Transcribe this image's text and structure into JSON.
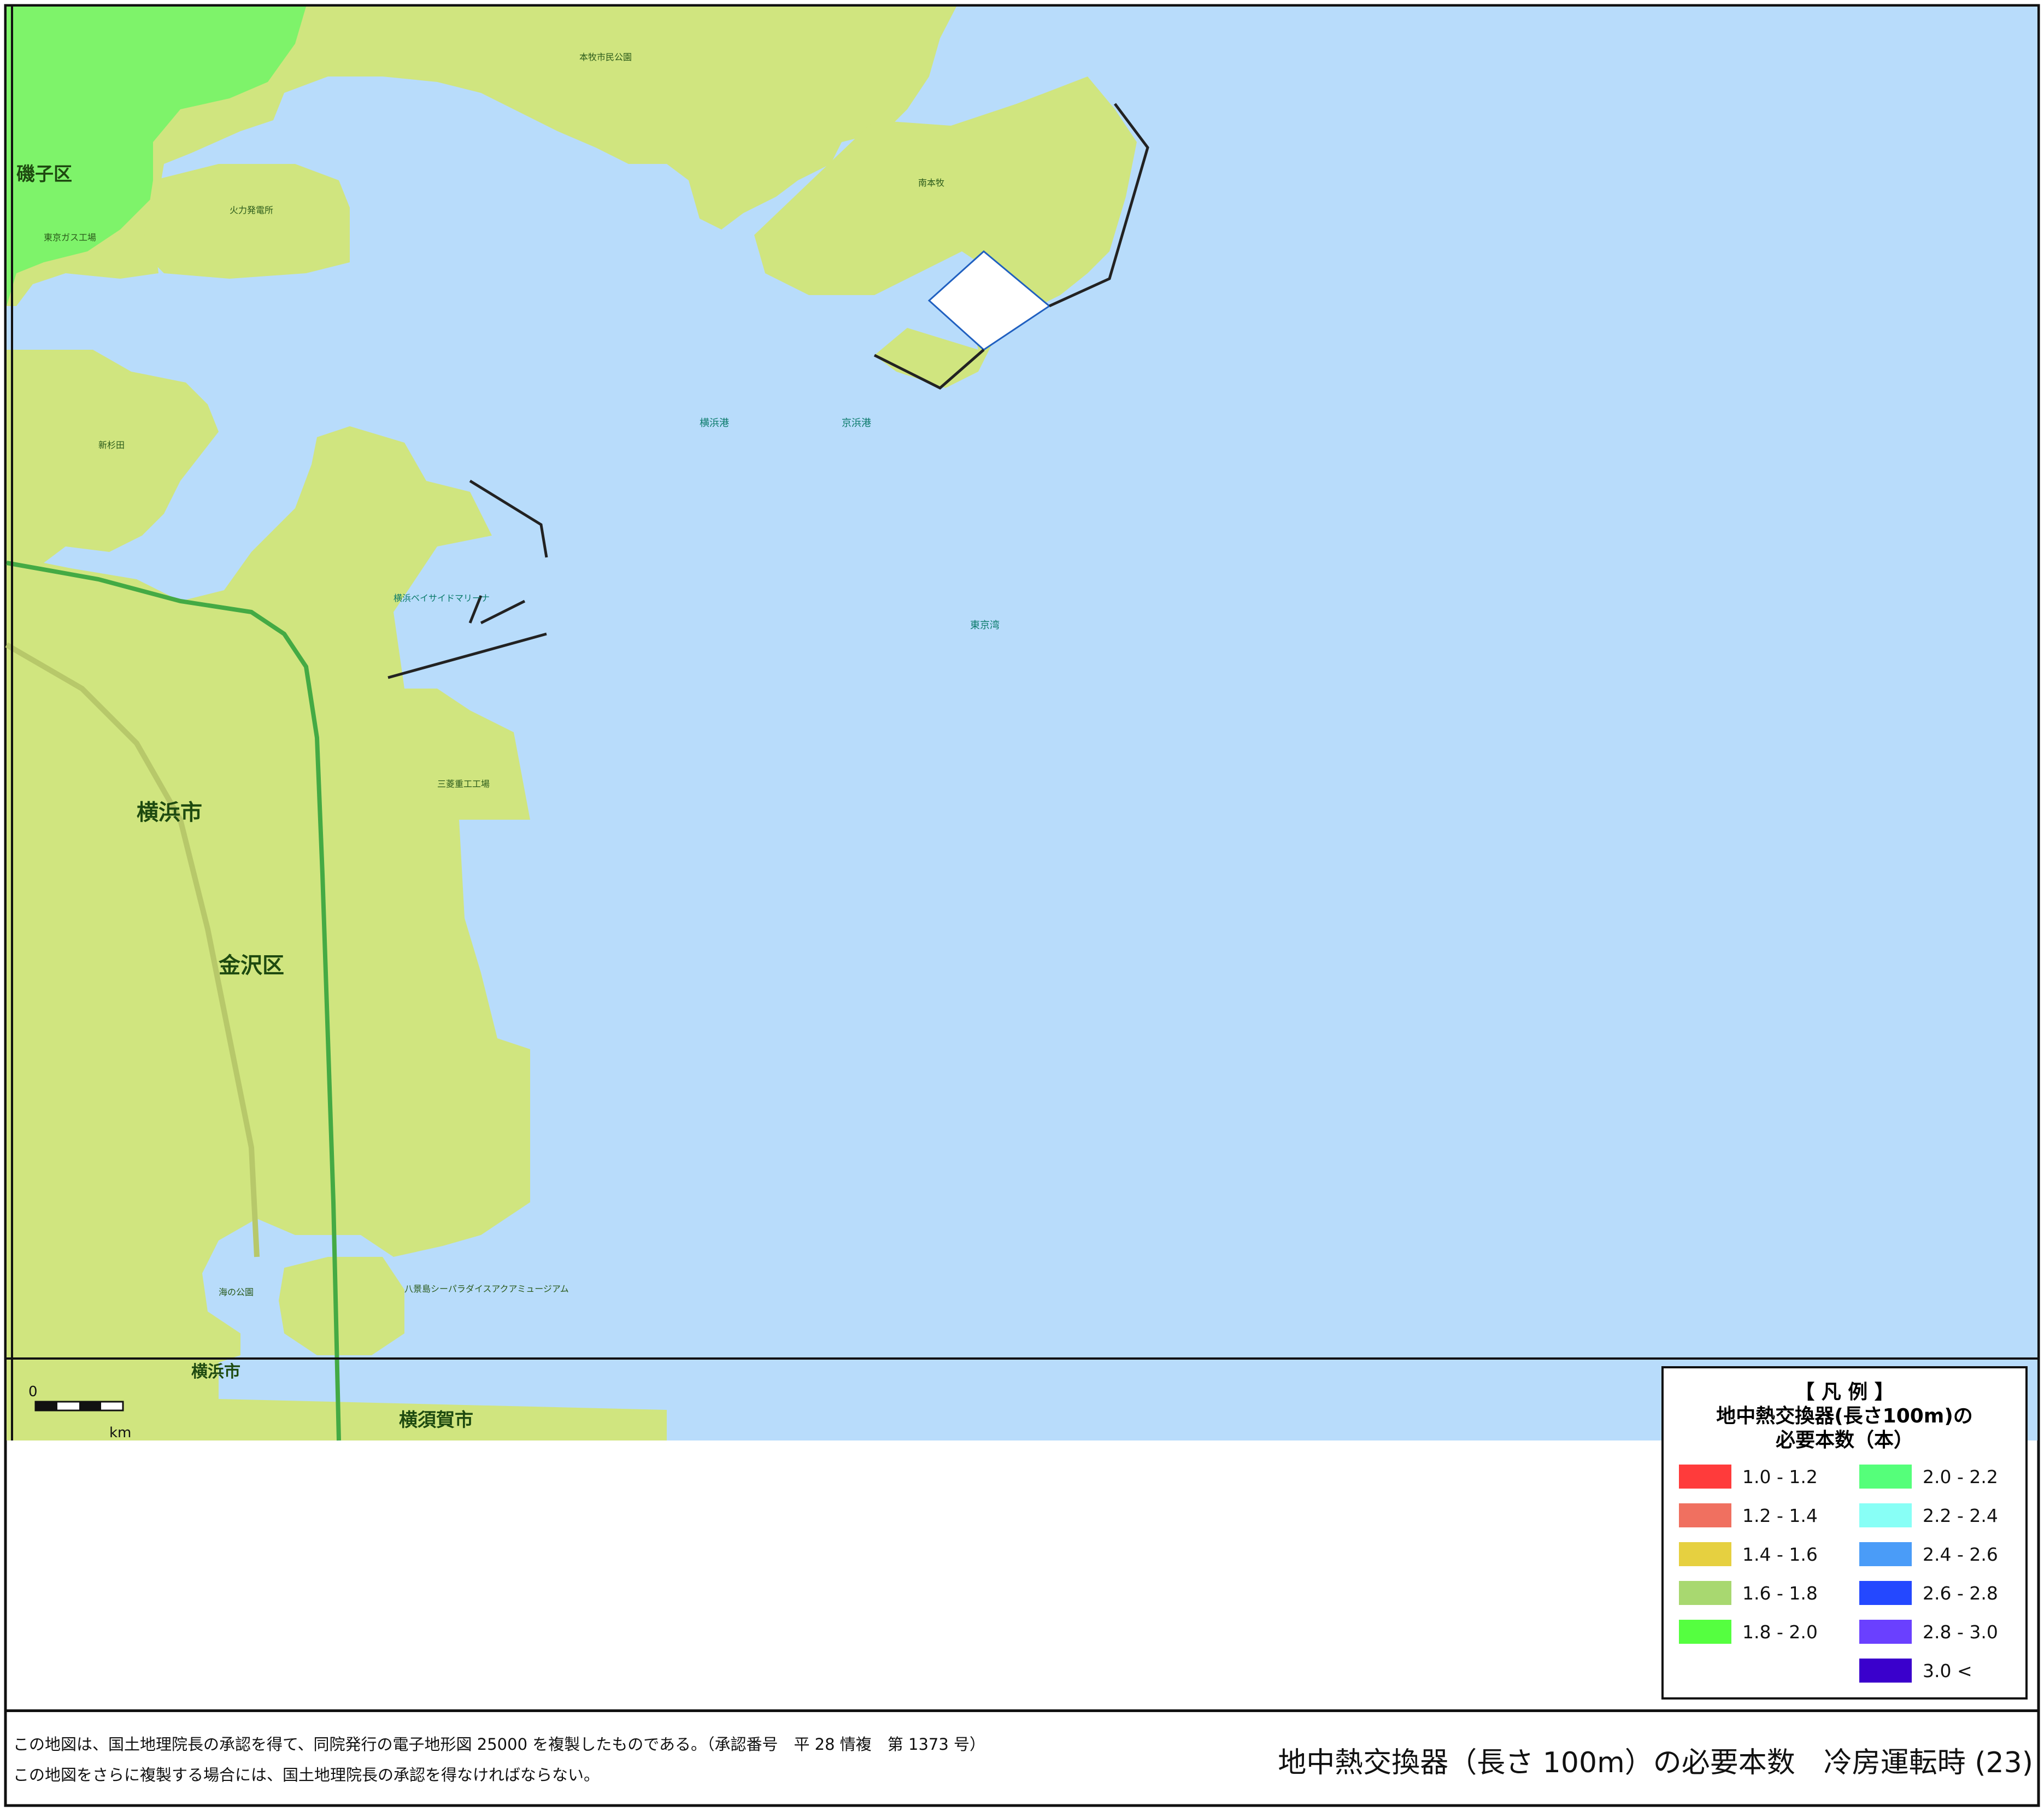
{
  "colors": {
    "sea": "#b8dcfb",
    "land_1_6_1_8": "#d0e57f",
    "land_1_8_2_0": "#7ef36a",
    "border": "#111111"
  },
  "map_labels": {
    "ward_isogo": "磯子区",
    "city_yokohama": "横浜市",
    "ward_kanazawa": "金沢区",
    "city_yokosuka_side": "横浜市",
    "city_yokosuka": "横須賀市",
    "bay_name": "東京湾",
    "port1": "横浜港",
    "port2": "京浜港",
    "park": "海の公園",
    "aquarium": "八景島シーパラダイスアクアミュージアム",
    "marina": "横浜ベイサイドマリーナ",
    "power_plant": "火力発電所",
    "gas": "東京ガス工場",
    "station": "新杉田",
    "honmoku": "本牧市民公園",
    "minami_honmoku": "南本牧",
    "mitsubishi": "三菱重工工場",
    "scale_zero": "0",
    "scale_unit": "km"
  },
  "legend": {
    "title": "【 凡 例 】",
    "subtitle1": "地中熱交換器(長さ100m)の",
    "subtitle2": "必要本数（本）",
    "items": [
      {
        "label": "1.0 - 1.2",
        "color": "#ff3b3b"
      },
      {
        "label": "1.2 - 1.4",
        "color": "#f07060"
      },
      {
        "label": "1.4 - 1.6",
        "color": "#e6d040"
      },
      {
        "label": "1.6 - 1.8",
        "color": "#a8d870"
      },
      {
        "label": "1.8 - 2.0",
        "color": "#55ff40"
      },
      {
        "label": "2.0 - 2.2",
        "color": "#55ff7a"
      },
      {
        "label": "2.2 - 2.4",
        "color": "#88fff6"
      },
      {
        "label": "2.4 - 2.6",
        "color": "#4a9cf8"
      },
      {
        "label": "2.6 - 2.8",
        "color": "#2448ff"
      },
      {
        "label": "2.8 - 3.0",
        "color": "#6a40ff"
      },
      {
        "label": "3.0 <",
        "color": "#3a00cc"
      }
    ]
  },
  "footer": {
    "credit1": "この地図は、国土地理院長の承認を得て、同院発行の電子地形図 25000 を複製したものである。（承認番号　平 28 情複　第 1373 号）",
    "credit2": "この地図をさらに複製する場合には、国土地理院長の承認を得なければならない。",
    "title": "地中熱交換器（長さ 100m）の必要本数　冷房運転時 (23)"
  }
}
